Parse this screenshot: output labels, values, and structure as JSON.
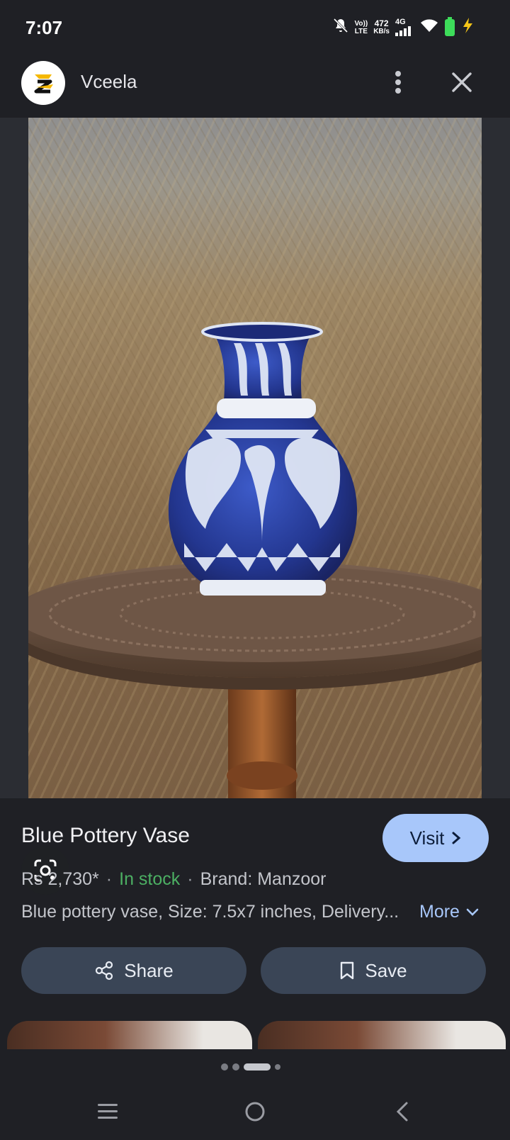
{
  "status": {
    "time": "7:07",
    "volte_top": "Vo))",
    "volte_bottom": "LTE",
    "speed_value": "472",
    "speed_unit": "KB/s",
    "network": "4G"
  },
  "header": {
    "site_name": "Vceela"
  },
  "product": {
    "title": "Blue Pottery Vase",
    "visit_label": "Visit",
    "price": "Rs 2,730*",
    "stock": "In stock",
    "brand": "Brand: Manzoor",
    "description": "Blue pottery vase, Size: 7.5x7 inches, Delivery...",
    "more_label": "More"
  },
  "actions": {
    "share_label": "Share",
    "save_label": "Save"
  },
  "pager": {
    "count": 4,
    "active_index": 2
  },
  "colors": {
    "accent": "#a8c7fa",
    "in_stock": "#4caf63",
    "pill_bg": "#3a4556",
    "background": "#1f2025"
  }
}
